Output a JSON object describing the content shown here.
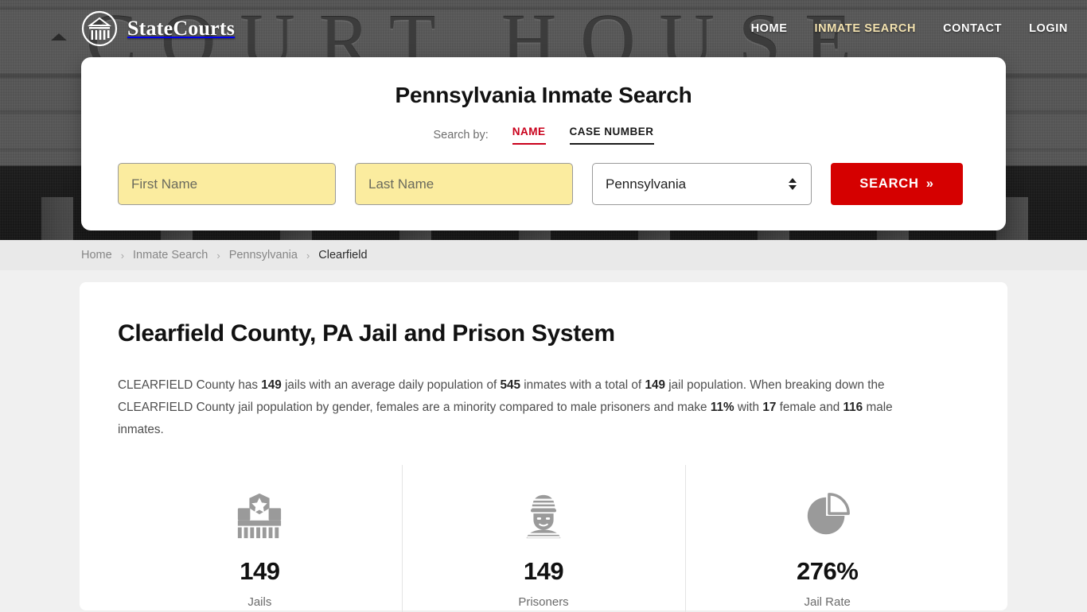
{
  "header": {
    "brand_name": "StateCourts",
    "brand_icon": "courthouse-circle-logo",
    "background_word": "COURT HOUSE",
    "nav": [
      {
        "label": "HOME",
        "active": false
      },
      {
        "label": "INMATE SEARCH",
        "active": true
      },
      {
        "label": "CONTACT",
        "active": false
      },
      {
        "label": "LOGIN",
        "active": false
      }
    ]
  },
  "search_card": {
    "title": "Pennsylvania Inmate Search",
    "search_by_label": "Search by:",
    "tabs": [
      {
        "label": "NAME",
        "active": true
      },
      {
        "label": "CASE NUMBER",
        "active": false
      }
    ],
    "first_name_placeholder": "First Name",
    "first_name_value": "",
    "last_name_placeholder": "Last Name",
    "last_name_value": "",
    "state_selected": "Pennsylvania",
    "search_button_label": "SEARCH",
    "search_button_chevrons": "»"
  },
  "breadcrumb": {
    "separator": "›",
    "items": [
      {
        "label": "Home",
        "current": false
      },
      {
        "label": "Inmate Search",
        "current": false
      },
      {
        "label": "Pennsylvania",
        "current": false
      },
      {
        "label": "Clearfield",
        "current": true
      }
    ]
  },
  "main": {
    "title": "Clearfield County, PA Jail and Prison System",
    "paragraph": {
      "p1": "CLEARFIELD County has ",
      "b1": "149",
      "p2": " jails with an average daily population of ",
      "b2": "545",
      "p3": " inmates with a total of ",
      "b3": "149",
      "p4": " jail population. When breaking down the CLEARFIELD County jail population by gender, females are a minority compared to male prisoners and make ",
      "b4": "11%",
      "p5": " with ",
      "b5": "17",
      "p6": " female and ",
      "b6": "116",
      "p7": " male inmates."
    },
    "stats": [
      {
        "icon": "jail-building-icon",
        "value": "149",
        "label": "Jails"
      },
      {
        "icon": "prisoner-icon",
        "value": "149",
        "label": "Prisoners"
      },
      {
        "icon": "pie-chart-icon",
        "value": "276%",
        "label": "Jail Rate"
      }
    ]
  },
  "colors": {
    "accent_red": "#d50000",
    "tab_active_red": "#c9001b",
    "autofill_yellow": "#fbec9f",
    "page_bg": "#f0f0f0",
    "breadcrumb_bg": "#e9e9e9",
    "icon_gray": "#9a9a9a"
  }
}
